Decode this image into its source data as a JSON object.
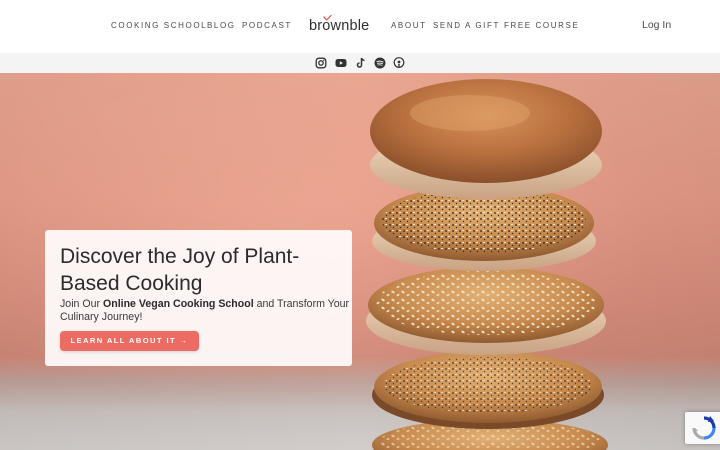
{
  "header": {
    "nav_left": [
      "COOKING SCHOOL",
      "BLOG",
      "PODCAST"
    ],
    "logo_text": "brownble",
    "nav_right": [
      "ABOUT",
      "SEND A GIFT",
      "FREE COURSE"
    ],
    "login_label": "Log In"
  },
  "social": {
    "icons": [
      "instagram-icon",
      "youtube-icon",
      "tiktok-icon",
      "spotify-icon",
      "podcast-icon"
    ]
  },
  "hero": {
    "title": "Discover the Joy of Plant-Based Cooking",
    "subtitle_prefix": "Join Our ",
    "subtitle_bold": "Online Vegan Cooking School",
    "subtitle_suffix": " and Transform Your Culinary Journey!",
    "cta_label": "LEARN ALL ABOUT IT →"
  },
  "colors": {
    "accent": "#ec6b62",
    "hero_background": "#e59a86",
    "text_dark": "#2b2b2b",
    "social_bar": "#f4f4f4"
  }
}
